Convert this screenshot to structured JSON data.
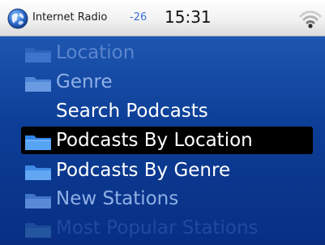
{
  "status_bar": {
    "app_title": "Internet Radio",
    "signal_level": "-26",
    "time": "15:31"
  },
  "menu": {
    "items": [
      {
        "label": "Location",
        "icon": "folder-icon",
        "state": "dim"
      },
      {
        "label": "Genre",
        "icon": "folder-icon",
        "state": "mid"
      },
      {
        "label": "Search Podcasts",
        "icon": "",
        "state": "normal"
      },
      {
        "label": "Podcasts By Location",
        "icon": "folder-icon",
        "state": "selected"
      },
      {
        "label": "Podcasts By Genre",
        "icon": "folder-icon",
        "state": "normal"
      },
      {
        "label": "New Stations",
        "icon": "folder-icon",
        "state": "mid"
      },
      {
        "label": "Most Popular Stations",
        "icon": "folder-icon",
        "state": "fade"
      }
    ]
  },
  "colors": {
    "background_top": "#3f78c8",
    "background_bottom": "#082e82",
    "selection": "#000000",
    "signal_text": "#3b74d4"
  }
}
